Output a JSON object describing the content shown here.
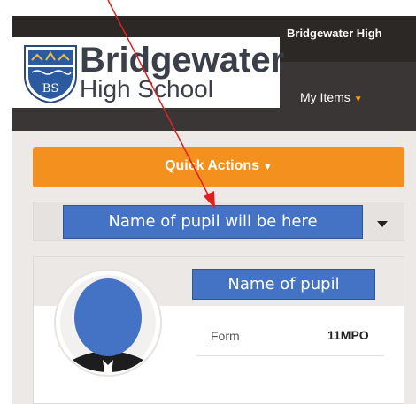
{
  "header": {
    "school_name": "Bridgewater High",
    "logo_line1": "Bridgewater",
    "logo_line2": "High School",
    "logo_crest_text": "BS",
    "nav_my_items": "My Items",
    "nav_caret": "▼"
  },
  "quick_actions": {
    "label": "Quick Actions",
    "caret": "▼"
  },
  "pupil_select": {
    "callout_text": "Name of pupil will be here"
  },
  "pupil_card": {
    "name_callout": "Name of pupil",
    "form_label": "Form",
    "form_value": "11MPO"
  },
  "colors": {
    "header_dark": "#2c2826",
    "header": "#3a3636",
    "accent_orange": "#f4911e",
    "callout_blue": "#4472c4",
    "arrow_red": "#e02020"
  },
  "icons": [
    "school-crest-icon",
    "caret-down-icon",
    "avatar-icon",
    "arrow-pointer"
  ]
}
